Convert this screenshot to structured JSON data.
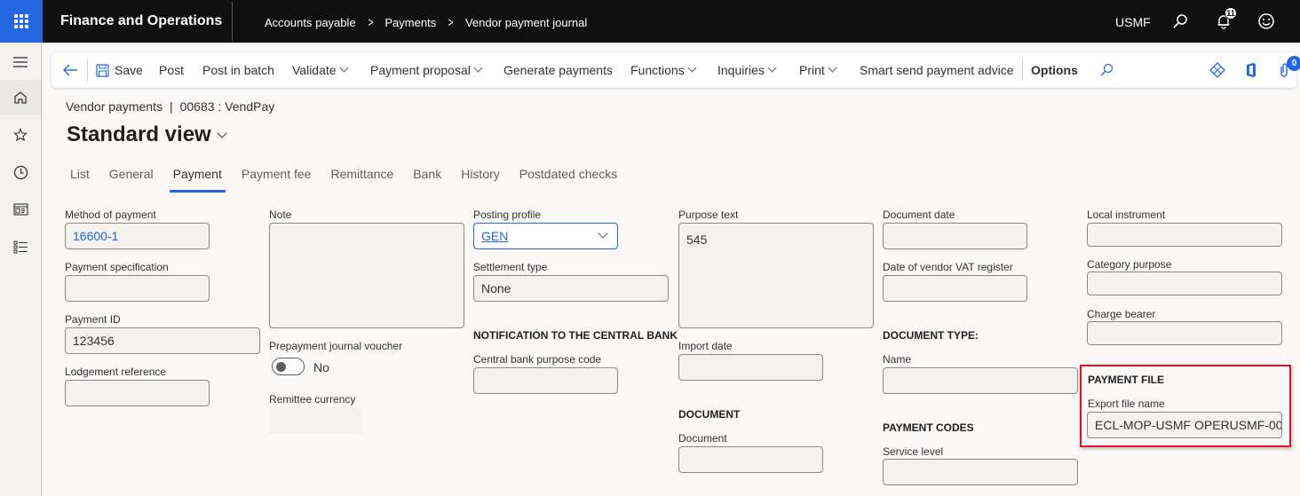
{
  "topbar": {
    "app_title": "Finance and Operations",
    "breadcrumb": [
      "Accounts payable",
      "Payments",
      "Vendor payment journal"
    ],
    "company": "USMF",
    "notification_count": "11",
    "icons": [
      "waffle-icon",
      "search-icon",
      "bell-icon",
      "smiley-icon"
    ]
  },
  "leftrail": {
    "items": [
      "hamburger-icon",
      "home-icon",
      "star-icon",
      "clock-icon",
      "workspace-icon",
      "list-icon"
    ]
  },
  "actionpane": {
    "back_icon": "back-arrow-icon",
    "save": "Save",
    "post": "Post",
    "post_in_batch": "Post in batch",
    "validate": "Validate",
    "payment_proposal": "Payment proposal",
    "generate_payments": "Generate payments",
    "functions": "Functions",
    "inquiries": "Inquiries",
    "print": "Print",
    "smart_send": "Smart send payment advice",
    "options": "Options",
    "attachments_count": "0"
  },
  "header": {
    "caption_left": "Vendor payments",
    "caption_sep": "|",
    "caption_right": "00683 : VendPay",
    "view_title": "Standard view"
  },
  "tabs": [
    {
      "label": "List",
      "active": false
    },
    {
      "label": "General",
      "active": false
    },
    {
      "label": "Payment",
      "active": true
    },
    {
      "label": "Payment fee",
      "active": false
    },
    {
      "label": "Remittance",
      "active": false
    },
    {
      "label": "Bank",
      "active": false
    },
    {
      "label": "History",
      "active": false
    },
    {
      "label": "Postdated checks",
      "active": false
    }
  ],
  "form": {
    "method_of_payment": {
      "label": "Method of payment",
      "value": "16600-1"
    },
    "payment_specification": {
      "label": "Payment specification",
      "value": ""
    },
    "payment_id": {
      "label": "Payment ID",
      "value": "123456"
    },
    "lodgement_reference": {
      "label": "Lodgement reference",
      "value": ""
    },
    "note": {
      "label": "Note",
      "value": ""
    },
    "prepayment_journal_voucher": {
      "label": "Prepayment journal voucher",
      "value": "No"
    },
    "remittee_currency": {
      "label": "Remittee currency",
      "value": ""
    },
    "posting_profile": {
      "label": "Posting profile",
      "value": "GEN"
    },
    "settlement_type": {
      "label": "Settlement type",
      "value": "None"
    },
    "central_bank_section": "NOTIFICATION TO THE CENTRAL BANK",
    "central_bank_purpose_code": {
      "label": "Central bank purpose code",
      "value": ""
    },
    "purpose_text": {
      "label": "Purpose text",
      "value": "545"
    },
    "import_date": {
      "label": "Import date",
      "value": ""
    },
    "document_section": "DOCUMENT",
    "document": {
      "label": "Document",
      "value": ""
    },
    "document_date": {
      "label": "Document date",
      "value": ""
    },
    "vat_register_date": {
      "label": "Date of vendor VAT register",
      "value": ""
    },
    "document_type_section": "DOCUMENT TYPE:",
    "name": {
      "label": "Name",
      "value": ""
    },
    "payment_codes_section": "PAYMENT CODES",
    "service_level": {
      "label": "Service level",
      "value": ""
    },
    "local_instrument": {
      "label": "Local instrument",
      "value": ""
    },
    "category_purpose": {
      "label": "Category purpose",
      "value": ""
    },
    "charge_bearer": {
      "label": "Charge bearer",
      "value": ""
    },
    "payment_file_section": "PAYMENT FILE",
    "export_file_name": {
      "label": "Export file name",
      "value": "ECL-MOP-USMF OPERUSMF-00..."
    }
  },
  "colors": {
    "accent": "#2266e3",
    "topbar": "#111010",
    "highlight": "#e81123"
  }
}
